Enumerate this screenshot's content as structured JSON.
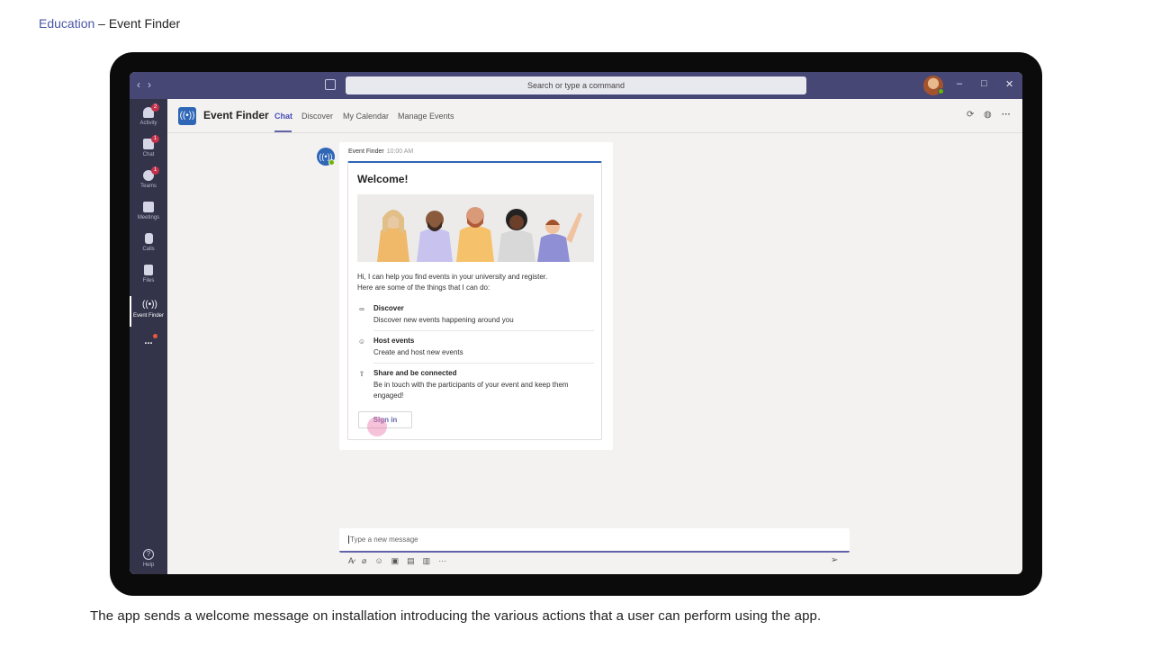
{
  "page": {
    "header_link": "Education",
    "header_rest": " – Event Finder",
    "caption": "The app sends a welcome message on installation introducing the various actions that a user can perform using the app."
  },
  "titlebar": {
    "search_placeholder": "Search or type a command",
    "minimize": "–",
    "maximize": "□",
    "close": "✕"
  },
  "rail": {
    "items": [
      {
        "label": "Activity",
        "badge": "2"
      },
      {
        "label": "Chat",
        "badge": "1"
      },
      {
        "label": "Teams",
        "badge": "1"
      },
      {
        "label": "Meetings"
      },
      {
        "label": "Calls"
      },
      {
        "label": "Files"
      },
      {
        "label": "Event Finder"
      }
    ],
    "more": "...",
    "help": "Help"
  },
  "app": {
    "name": "Event Finder",
    "tabs": [
      "Chat",
      "Discover",
      "My Calendar",
      "Manage Events"
    ]
  },
  "message": {
    "sender": "Event Finder",
    "time": "10:00 AM",
    "card": {
      "title": "Welcome!",
      "intro_line1": "Hi, I can help you find events in your university and register.",
      "intro_line2": "Here are some of the things that I can do:",
      "features": [
        {
          "title": "Discover",
          "desc": "Discover new events happening around you",
          "icon": "binoculars-icon"
        },
        {
          "title": "Host events",
          "desc": "Create and host new events",
          "icon": "person-icon"
        },
        {
          "title": "Share and be connected",
          "desc": "Be in touch with the participants of your event and keep them engaged!",
          "icon": "share-icon"
        }
      ],
      "button": "Sign in"
    }
  },
  "compose": {
    "placeholder": "Type a new message"
  },
  "colors": {
    "titlebar": "#464775",
    "rail": "#33344a",
    "accent": "#6264a7",
    "badge": "#c4314b"
  }
}
